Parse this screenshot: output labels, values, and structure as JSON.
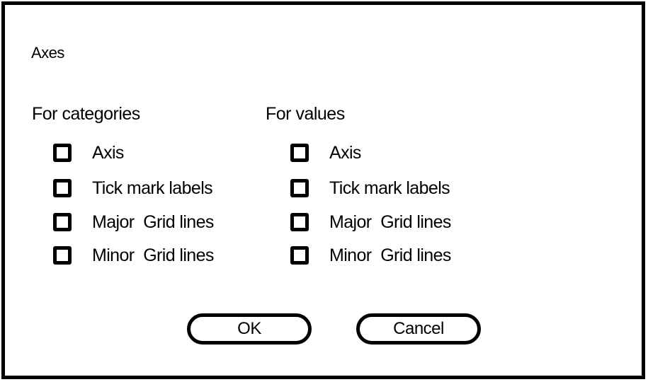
{
  "dialog": {
    "title": "Axes"
  },
  "categories": {
    "header": "For categories",
    "options": [
      {
        "label": "Axis",
        "checked": false
      },
      {
        "label": "Tick mark labels",
        "checked": false
      },
      {
        "label": "Major  Grid lines",
        "checked": false
      },
      {
        "label": "Minor  Grid lines",
        "checked": false
      }
    ]
  },
  "values": {
    "header": "For values",
    "options": [
      {
        "label": "Axis",
        "checked": false
      },
      {
        "label": "Tick mark labels",
        "checked": false
      },
      {
        "label": "Major  Grid lines",
        "checked": false
      },
      {
        "label": "Minor  Grid lines",
        "checked": false
      }
    ]
  },
  "buttons": {
    "ok": "OK",
    "cancel": "Cancel"
  }
}
